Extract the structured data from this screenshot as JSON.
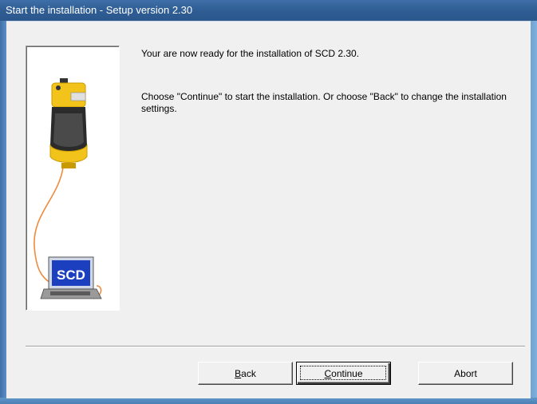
{
  "window": {
    "title": "Start the installation - Setup version 2.30"
  },
  "message": {
    "line1": "Your are now ready for the installation of SCD 2.30.",
    "line2": "Choose \"Continue\" to start the installation. Or choose \"Back\" to change the installation settings."
  },
  "illustration": {
    "laptop_label": "SCD",
    "icons": [
      "safety-laser-scanner-icon",
      "laptop-icon",
      "cable-icon"
    ]
  },
  "buttons": {
    "back": {
      "mnemonic": "B",
      "rest": "ack"
    },
    "continue": {
      "mnemonic": "C",
      "rest": "ontinue"
    },
    "abort": "Abort"
  },
  "colors": {
    "titlebar": "#2f5d94",
    "dialog_face": "#f0f0f0",
    "scanner_yellow": "#f2c31a",
    "cable_orange": "#f08a3c",
    "scd_screen_blue": "#1c3fbf"
  }
}
